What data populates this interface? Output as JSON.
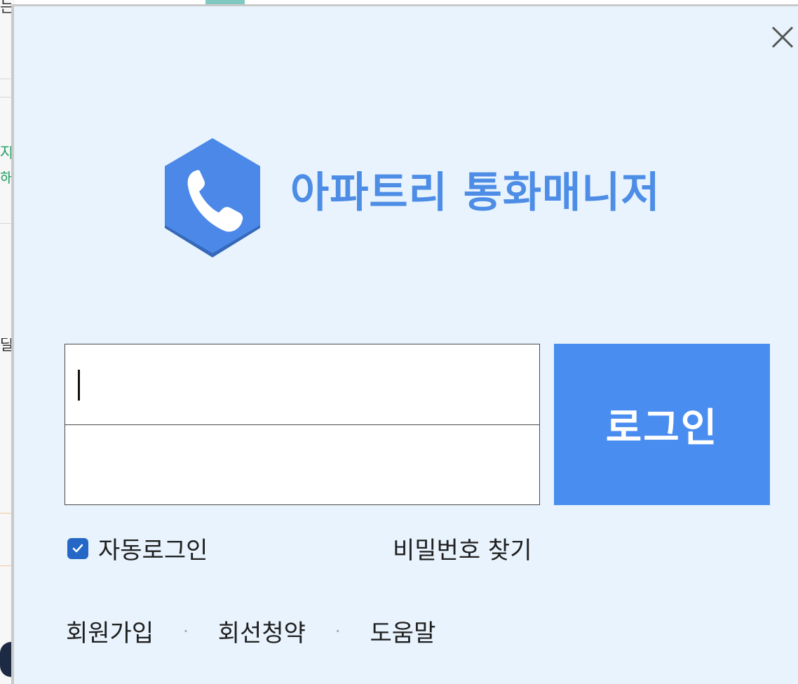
{
  "background_app": {
    "fragments": [
      "는",
      "자",
      "해",
      "달"
    ]
  },
  "dialog": {
    "close_icon": "close-icon",
    "logo_icon": "phone-hexagon-icon",
    "title": "아파트리 통화매니저",
    "id_field": {
      "value": "",
      "placeholder": ""
    },
    "password_field": {
      "value": "",
      "placeholder": ""
    },
    "login_button": "로그인",
    "auto_login": {
      "label": "자동로그인",
      "checked": true
    },
    "find_password": "비밀번호 찾기",
    "links": {
      "signup": "회원가입",
      "separator_1": "·",
      "line_subscription": "회선청약",
      "separator_2": "·",
      "help": "도움말"
    }
  },
  "colors": {
    "dialog_bg": "#e8f3fd",
    "brand": "#4d8de6",
    "login_button": "#4a8df0",
    "checkbox": "#2567c7"
  }
}
